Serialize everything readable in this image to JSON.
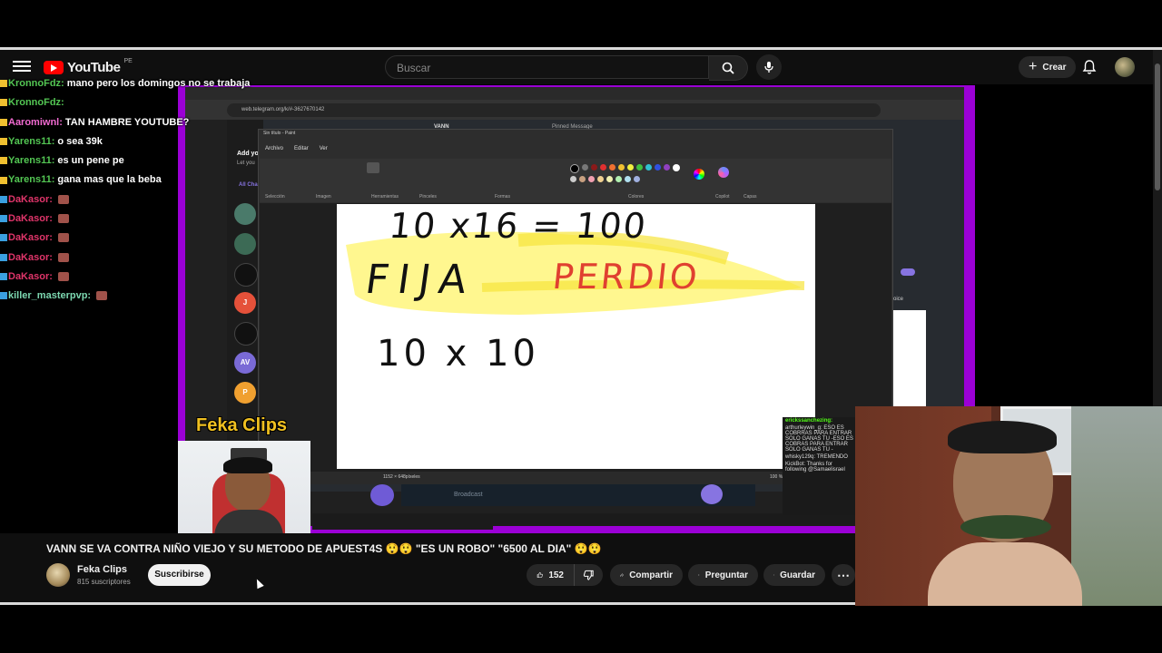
{
  "header": {
    "logo_text": "YouTube",
    "logo_country": "PE",
    "search_placeholder": "Buscar",
    "create_label": "Crear"
  },
  "chat": [
    {
      "user": "KronnoFdz:",
      "msg": "mano pero los domingos no se trabaja",
      "color": "#53c653"
    },
    {
      "user": "KronnoFdz:",
      "msg": "",
      "color": "#53c653"
    },
    {
      "user": "Aaromiwnl:",
      "msg": "TAN HAMBRE YOUTUBE?",
      "color": "#f06ad0"
    },
    {
      "user": "Yarens11:",
      "msg": "o sea 39k",
      "color": "#53c653"
    },
    {
      "user": "Yarens11:",
      "msg": "es un pene pe",
      "color": "#53c653"
    },
    {
      "user": "Yarens11:",
      "msg": "gana mas que la beba",
      "color": "#53c653"
    },
    {
      "user": "DaKasor:",
      "msg": "",
      "color": "#e0356a"
    },
    {
      "user": "DaKasor:",
      "msg": "",
      "color": "#e0356a"
    },
    {
      "user": "DaKasor:",
      "msg": "",
      "color": "#e0356a"
    },
    {
      "user": "DaKasor:",
      "msg": "",
      "color": "#e0356a"
    },
    {
      "user": "DaKasor:",
      "msg": "",
      "color": "#e0356a"
    },
    {
      "user": "killer_masterpvp:",
      "msg": "",
      "color": "#7cd7b0"
    }
  ],
  "stream": {
    "url": "web.telegram.org/k/#-3627670142",
    "paint_title": "Sin título - Paint",
    "paint_menu": [
      "Archivo",
      "Editar",
      "Ver"
    ],
    "ribbon_labels": [
      "Selección",
      "Imagen",
      "Herramientas",
      "Pinceles",
      "Formas",
      "Colores",
      "Copilot",
      "Capas"
    ],
    "canvas_size": "1152 × 648píxeles",
    "zoom": "100 %",
    "telegram_input": "Broadcast",
    "vann": "VANN",
    "pinned": "Pinned Message",
    "sidebar_add": "Add you",
    "sidebar_letyou": "Let you",
    "sidebar_all": "All Cha",
    "drawing_line1": "10 x16 = 100",
    "drawing_fija": "FIJA",
    "drawing_perdio": "PERDIO",
    "drawing_line2": "10 x 10",
    "avatar_labels": [
      "J",
      "AV",
      "P"
    ],
    "choice_label": "oice",
    "overlay_logo": "Feka Clips",
    "overlay_chat": [
      "erickssanchezing:",
      "arthurleywin_g: ESO ES COBRRAS PARA ENTRAR SOLO GANAS TU -ESO ES COBRAS PARA ENTRAR SOLO GANAS TU -",
      "whisky129q: TREMENDO",
      "KickBot: Thanks for following @Samaelisrael"
    ]
  },
  "video": {
    "title": "VANN SE VA CONTRA NIÑO VIEJO Y SU METODO DE APUEST4S 😲😲 \"ES UN ROBO\" \"6500 AL DIA\" 😲😲",
    "channel": "Feka Clips",
    "subscribers": "815 suscriptores",
    "subscribe_label": "Suscribirse",
    "likes": "152",
    "share_label": "Compartir",
    "ask_label": "Preguntar",
    "save_label": "Guardar"
  },
  "colors": {
    "frame_purple": "#9b00d6",
    "subscribe_bg": "#f1f1f1",
    "youtube_red": "#ff0000",
    "highlight_yellow": "#fff46a"
  }
}
